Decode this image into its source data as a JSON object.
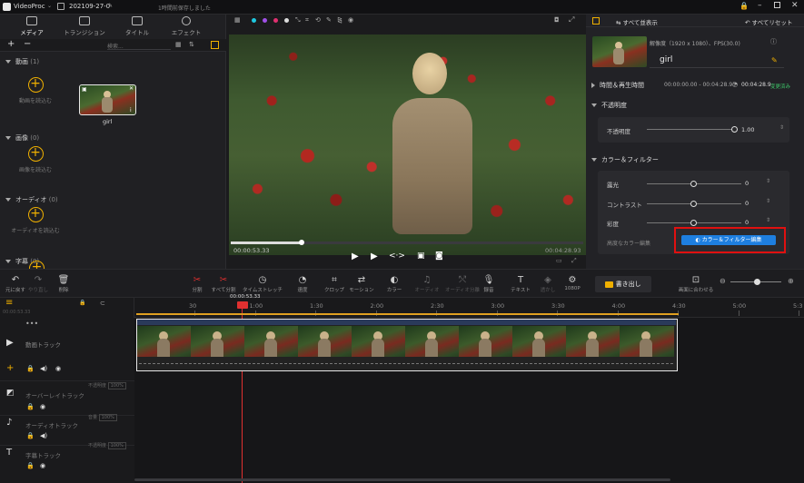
{
  "titlebar": {
    "app_name": "VideoProc",
    "project": "202109-27-0",
    "save_status": "1時間前保存しました"
  },
  "media_panel": {
    "tabs": [
      {
        "label": "メディア",
        "icon": "media-icon",
        "active": true
      },
      {
        "label": "トランジション",
        "icon": "transition-icon",
        "active": false
      },
      {
        "label": "タイトル",
        "icon": "title-icon",
        "active": false
      },
      {
        "label": "エフェクト",
        "icon": "effect-icon",
        "active": false
      }
    ],
    "search_placeholder": "検索...",
    "sections": [
      {
        "title": "動画",
        "count": "(1)",
        "add_label": "動画を読込む"
      },
      {
        "title": "画像",
        "count": "(0)",
        "add_label": "画像を読込む"
      },
      {
        "title": "オーディオ",
        "count": "(0)",
        "add_label": "オーディオを読込む"
      },
      {
        "title": "字幕",
        "count": "(0)",
        "add_label": ""
      }
    ],
    "clip_name": "girl"
  },
  "preview": {
    "current_time": "00:00:53.33",
    "total_time": "00:04:28.93",
    "progress_fraction": 0.2
  },
  "inspector": {
    "show_all": "すべて並表示",
    "reset_all": "すべてリセット",
    "clip_info": "解像度（1920 x 1080）、FPS(30.0)",
    "clip_name": "girl",
    "time_section": "時間＆再生時間",
    "time_start": "00:00:00.00 - 00:04:28.93",
    "time_duration": "00:04:28.9",
    "changed": "変更済み",
    "opacity_section": "不透明度",
    "opacity_label": "不透明度",
    "opacity_value": "1.00",
    "color_section": "カラー＆フィルター",
    "exposure_label": "露光",
    "exposure_value": "0",
    "contrast_label": "コントラスト",
    "contrast_value": "0",
    "saturation_label": "彩度",
    "saturation_value": "0",
    "advanced_label": "高度なカラー編集",
    "advanced_button": "カラー＆フィルター編集",
    "accent": "#1e7fe0",
    "highlight": "#e01010"
  },
  "toolbar": {
    "buttons": [
      {
        "label": "元に戻す",
        "icon": "undo-icon"
      },
      {
        "label": "やり直し",
        "icon": "redo-icon"
      },
      {
        "label": "削除",
        "icon": "trash-icon"
      },
      {
        "label": "分割",
        "icon": "scissors-icon"
      },
      {
        "label": "すべて分割",
        "icon": "split-all-icon"
      },
      {
        "label": "タイムストレッチ",
        "icon": "speed-icon"
      },
      {
        "label": "速度",
        "icon": "gauge-icon"
      },
      {
        "label": "クロップ",
        "icon": "crop-icon"
      },
      {
        "label": "モーション",
        "icon": "motion-icon"
      },
      {
        "label": "カラー",
        "icon": "palette-icon"
      },
      {
        "label": "オーディオ",
        "icon": "audio-icon"
      },
      {
        "label": "オーディオ分離",
        "icon": "audio-split-icon"
      },
      {
        "label": "録音",
        "icon": "mic-icon"
      },
      {
        "label": "テキスト",
        "icon": "text-icon"
      },
      {
        "label": "透かし",
        "icon": "watermark-icon"
      },
      {
        "label": "1080P",
        "icon": "resolution-icon"
      }
    ],
    "export_label": "書き出し",
    "fit_label": "画面に合わせる"
  },
  "timeline": {
    "playhead_time": "00:00:53.33",
    "time_readout": "00:00:53.33",
    "ticks": [
      "30",
      "1:00",
      "1:30",
      "2:00",
      "2:30",
      "3:00",
      "3:30",
      "4:00",
      "4:30",
      "5:00",
      "5:3"
    ],
    "tracks": [
      {
        "name": "動画トラック",
        "icon": "video-track-icon"
      },
      {
        "name": "オーバーレイトラック",
        "icon": "overlay-track-icon",
        "opacity_label": "不透明度",
        "opacity_value": "100%"
      },
      {
        "name": "オーディオトラック",
        "icon": "music-note-icon",
        "opacity_label": "音量",
        "opacity_value": "100%"
      },
      {
        "name": "字幕トラック",
        "icon": "subtitle-track-icon",
        "opacity_label": "不透明度",
        "opacity_value": "100%"
      }
    ]
  }
}
